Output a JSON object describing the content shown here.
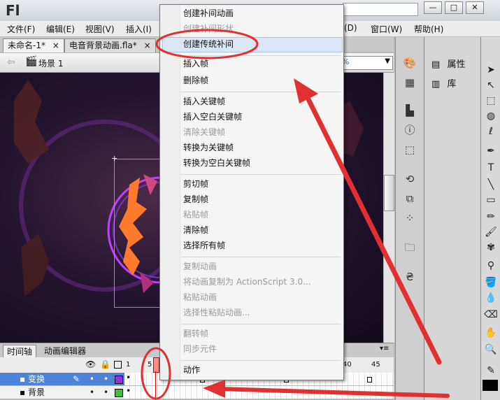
{
  "app": {
    "logo": "Fl"
  },
  "window": {
    "minimize": "—",
    "restore": "□",
    "close": "✕"
  },
  "menubar": {
    "items": [
      "文件(F)",
      "编辑(E)",
      "视图(V)",
      "插入(I)",
      "(D)",
      "窗口(W)",
      "帮助(H)"
    ]
  },
  "doc_tabs": [
    {
      "label": "未命名-1*",
      "close": "×"
    },
    {
      "label": "电音背景动画.fla*",
      "close": "×"
    }
  ],
  "scene": {
    "label": "场景 1",
    "zoom": "%"
  },
  "timeline": {
    "tabs": [
      "时间轴",
      "动画编辑器"
    ],
    "frame_numbers": [
      "1",
      "5",
      "40",
      "45"
    ],
    "layers": [
      {
        "name": "变换",
        "selected": true,
        "color": "#9b30d9"
      },
      {
        "name": "背景",
        "selected": false,
        "color": "#40c040"
      }
    ]
  },
  "panels": {
    "properties": "属性",
    "library": "库"
  },
  "context_menu": {
    "items": [
      {
        "label": "创建补间动画",
        "enabled": true
      },
      {
        "label": "创建补间形状",
        "enabled": false
      },
      {
        "label": "创建传统补间",
        "enabled": true,
        "highlighted": true
      },
      {
        "label": "插入帧",
        "enabled": true
      },
      {
        "label": "删除帧",
        "enabled": true
      },
      {
        "label": "插入关键帧",
        "enabled": true
      },
      {
        "label": "插入空白关键帧",
        "enabled": true
      },
      {
        "label": "清除关键帧",
        "enabled": false
      },
      {
        "label": "转换为关键帧",
        "enabled": true
      },
      {
        "label": "转换为空白关键帧",
        "enabled": true
      },
      {
        "label": "剪切帧",
        "enabled": true
      },
      {
        "label": "复制帧",
        "enabled": true
      },
      {
        "label": "粘贴帧",
        "enabled": false
      },
      {
        "label": "清除帧",
        "enabled": true
      },
      {
        "label": "选择所有帧",
        "enabled": true
      },
      {
        "label": "复制动画",
        "enabled": false
      },
      {
        "label": "将动画复制为 ActionScript 3.0...",
        "enabled": false
      },
      {
        "label": "粘贴动画",
        "enabled": false
      },
      {
        "label": "选择性粘贴动画...",
        "enabled": false
      },
      {
        "label": "翻转帧",
        "enabled": false
      },
      {
        "label": "同步元件",
        "enabled": false
      },
      {
        "label": "动作",
        "enabled": true
      }
    ]
  },
  "colors": {
    "annotation": "#e03030",
    "selection": "#4b84d9"
  }
}
